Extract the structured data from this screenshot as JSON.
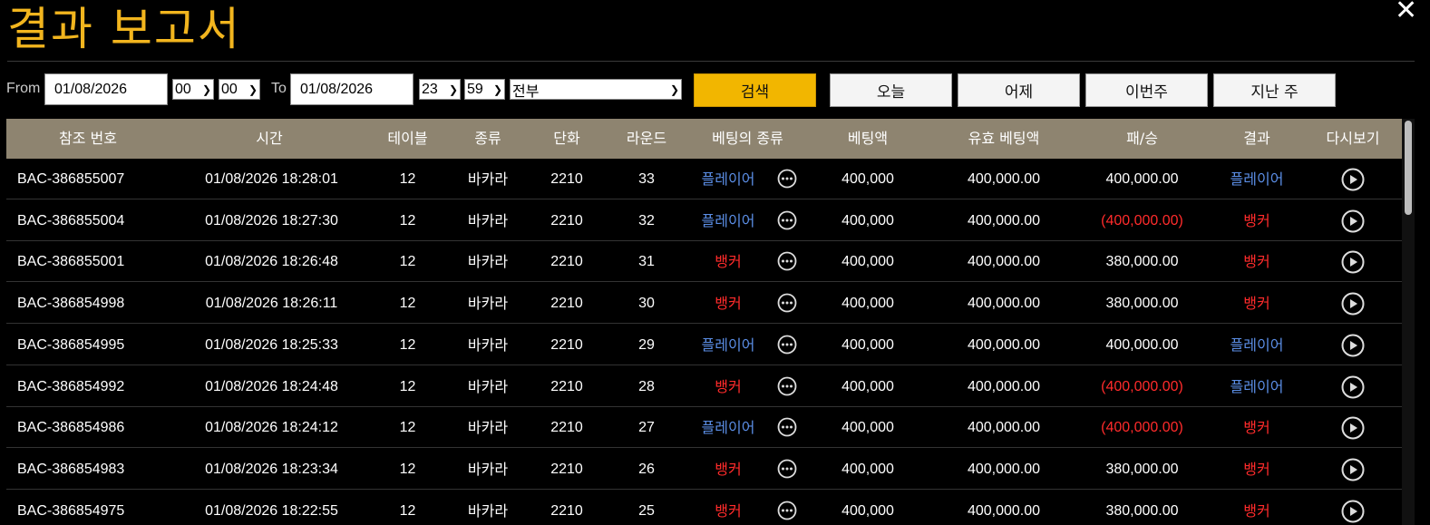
{
  "header": {
    "title": "결과 보고서",
    "close_label": "✕"
  },
  "filter": {
    "from_label": "From",
    "from_date": "01/08/2026",
    "from_hour": "00",
    "from_minute": "00",
    "to_label": "To",
    "to_date": "01/08/2026",
    "to_hour": "23",
    "to_minute": "59",
    "game_type": "전부",
    "search_label": "검색",
    "today_label": "오늘",
    "yesterday_label": "어제",
    "this_week_label": "이번주",
    "last_week_label": "지난 주"
  },
  "table": {
    "columns": [
      "참조 번호",
      "시간",
      "테이블",
      "종류",
      "단화",
      "라운드",
      "베팅의 종류",
      "베팅액",
      "유효 베팅액",
      "패/승",
      "결과",
      "다시보기"
    ],
    "rows": [
      {
        "ref": "BAC-386855007",
        "time": "01/08/2026 18:28:01",
        "table": "12",
        "kind": "바카라",
        "shoe": "2210",
        "round": "33",
        "bet_type": "플레이어",
        "bet_color": "blue",
        "bet": "400,000",
        "valid_bet": "400,000.00",
        "winloss": "400,000.00",
        "winloss_color": "white",
        "result": "플레이어",
        "result_color": "blue"
      },
      {
        "ref": "BAC-386855004",
        "time": "01/08/2026 18:27:30",
        "table": "12",
        "kind": "바카라",
        "shoe": "2210",
        "round": "32",
        "bet_type": "플레이어",
        "bet_color": "blue",
        "bet": "400,000",
        "valid_bet": "400,000.00",
        "winloss": "(400,000.00)",
        "winloss_color": "red",
        "result": "뱅커",
        "result_color": "red"
      },
      {
        "ref": "BAC-386855001",
        "time": "01/08/2026 18:26:48",
        "table": "12",
        "kind": "바카라",
        "shoe": "2210",
        "round": "31",
        "bet_type": "뱅커",
        "bet_color": "red",
        "bet": "400,000",
        "valid_bet": "400,000.00",
        "winloss": "380,000.00",
        "winloss_color": "white",
        "result": "뱅커",
        "result_color": "red"
      },
      {
        "ref": "BAC-386854998",
        "time": "01/08/2026 18:26:11",
        "table": "12",
        "kind": "바카라",
        "shoe": "2210",
        "round": "30",
        "bet_type": "뱅커",
        "bet_color": "red",
        "bet": "400,000",
        "valid_bet": "400,000.00",
        "winloss": "380,000.00",
        "winloss_color": "white",
        "result": "뱅커",
        "result_color": "red"
      },
      {
        "ref": "BAC-386854995",
        "time": "01/08/2026 18:25:33",
        "table": "12",
        "kind": "바카라",
        "shoe": "2210",
        "round": "29",
        "bet_type": "플레이어",
        "bet_color": "blue",
        "bet": "400,000",
        "valid_bet": "400,000.00",
        "winloss": "400,000.00",
        "winloss_color": "white",
        "result": "플레이어",
        "result_color": "blue"
      },
      {
        "ref": "BAC-386854992",
        "time": "01/08/2026 18:24:48",
        "table": "12",
        "kind": "바카라",
        "shoe": "2210",
        "round": "28",
        "bet_type": "뱅커",
        "bet_color": "red",
        "bet": "400,000",
        "valid_bet": "400,000.00",
        "winloss": "(400,000.00)",
        "winloss_color": "red",
        "result": "플레이어",
        "result_color": "blue"
      },
      {
        "ref": "BAC-386854986",
        "time": "01/08/2026 18:24:12",
        "table": "12",
        "kind": "바카라",
        "shoe": "2210",
        "round": "27",
        "bet_type": "플레이어",
        "bet_color": "blue",
        "bet": "400,000",
        "valid_bet": "400,000.00",
        "winloss": "(400,000.00)",
        "winloss_color": "red",
        "result": "뱅커",
        "result_color": "red"
      },
      {
        "ref": "BAC-386854983",
        "time": "01/08/2026 18:23:34",
        "table": "12",
        "kind": "바카라",
        "shoe": "2210",
        "round": "26",
        "bet_type": "뱅커",
        "bet_color": "red",
        "bet": "400,000",
        "valid_bet": "400,000.00",
        "winloss": "380,000.00",
        "winloss_color": "white",
        "result": "뱅커",
        "result_color": "red"
      },
      {
        "ref": "BAC-386854975",
        "time": "01/08/2026 18:22:55",
        "table": "12",
        "kind": "바카라",
        "shoe": "2210",
        "round": "25",
        "bet_type": "뱅커",
        "bet_color": "red",
        "bet": "400,000",
        "valid_bet": "400,000.00",
        "winloss": "380,000.00",
        "winloss_color": "white",
        "result": "뱅커",
        "result_color": "red"
      }
    ]
  },
  "icons": {
    "details": "ellipsis-circle-icon",
    "replay": "play-circle-icon",
    "close": "close-icon"
  },
  "colors": {
    "title": "#f2b51e",
    "header_bg": "#8e8470",
    "search_button": "#f2b600",
    "player_blue": "#5b8ee6",
    "banker_red": "#ff2b2b"
  }
}
